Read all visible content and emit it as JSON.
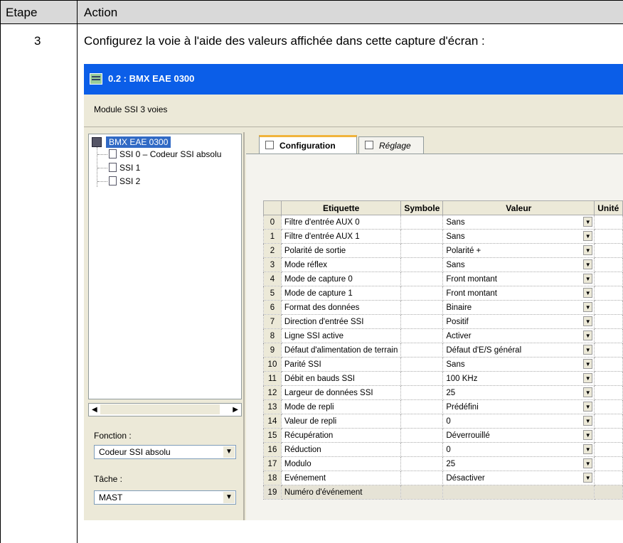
{
  "doc": {
    "col_step": "Etape",
    "col_action": "Action",
    "step_number": "3",
    "step_text": "Configurez la voie à l'aide des valeurs affichée dans cette capture d'écran :"
  },
  "window": {
    "title": "0.2 : BMX    EAE 0300",
    "module_desc": "Module SSI 3 voies"
  },
  "tree": {
    "root": "BMX EAE 0300",
    "items": [
      "SSI 0 – Codeur SSI absolu",
      "SSI 1",
      "SSI 2"
    ]
  },
  "fonction": {
    "label": "Fonction :",
    "value": "Codeur SSI absolu"
  },
  "tache": {
    "label": "Tâche :",
    "value": "MAST"
  },
  "tabs": {
    "configuration": "Configuration",
    "reglage": "Réglage"
  },
  "grid": {
    "headers": {
      "etiquette": "Etiquette",
      "symbole": "Symbole",
      "valeur": "Valeur",
      "unite": "Unité"
    },
    "rows": [
      {
        "idx": "0",
        "label": "Filtre d'entrée AUX 0",
        "value": "Sans"
      },
      {
        "idx": "1",
        "label": "Filtre d'entrée AUX 1",
        "value": "Sans"
      },
      {
        "idx": "2",
        "label": "Polarité de sortie",
        "value": "Polarité +"
      },
      {
        "idx": "3",
        "label": "Mode réflex",
        "value": "Sans"
      },
      {
        "idx": "4",
        "label": "Mode de capture 0",
        "value": "Front montant"
      },
      {
        "idx": "5",
        "label": "Mode de capture 1",
        "value": "Front montant"
      },
      {
        "idx": "6",
        "label": "Format des données",
        "value": "Binaire"
      },
      {
        "idx": "7",
        "label": "Direction d'entrée SSI",
        "value": "Positif"
      },
      {
        "idx": "8",
        "label": "Ligne SSI active",
        "value": "Activer"
      },
      {
        "idx": "9",
        "label": "Défaut d'alimentation de terrain",
        "value": "Défaut d'E/S général"
      },
      {
        "idx": "10",
        "label": "Parité SSI",
        "value": "Sans"
      },
      {
        "idx": "11",
        "label": "Débit en bauds SSI",
        "value": "100 KHz"
      },
      {
        "idx": "12",
        "label": "Largeur de données SSI",
        "value": "25"
      },
      {
        "idx": "13",
        "label": "Mode de repli",
        "value": "Prédéfini"
      },
      {
        "idx": "14",
        "label": "Valeur de repli",
        "value": "0"
      },
      {
        "idx": "15",
        "label": "Récupération",
        "value": "Déverrouillé"
      },
      {
        "idx": "16",
        "label": "Réduction",
        "value": "0"
      },
      {
        "idx": "17",
        "label": "Modulo",
        "value": "25"
      },
      {
        "idx": "18",
        "label": "Evénement",
        "value": "Désactiver"
      },
      {
        "idx": "19",
        "label": "Numéro d'événement",
        "value": ""
      }
    ]
  }
}
